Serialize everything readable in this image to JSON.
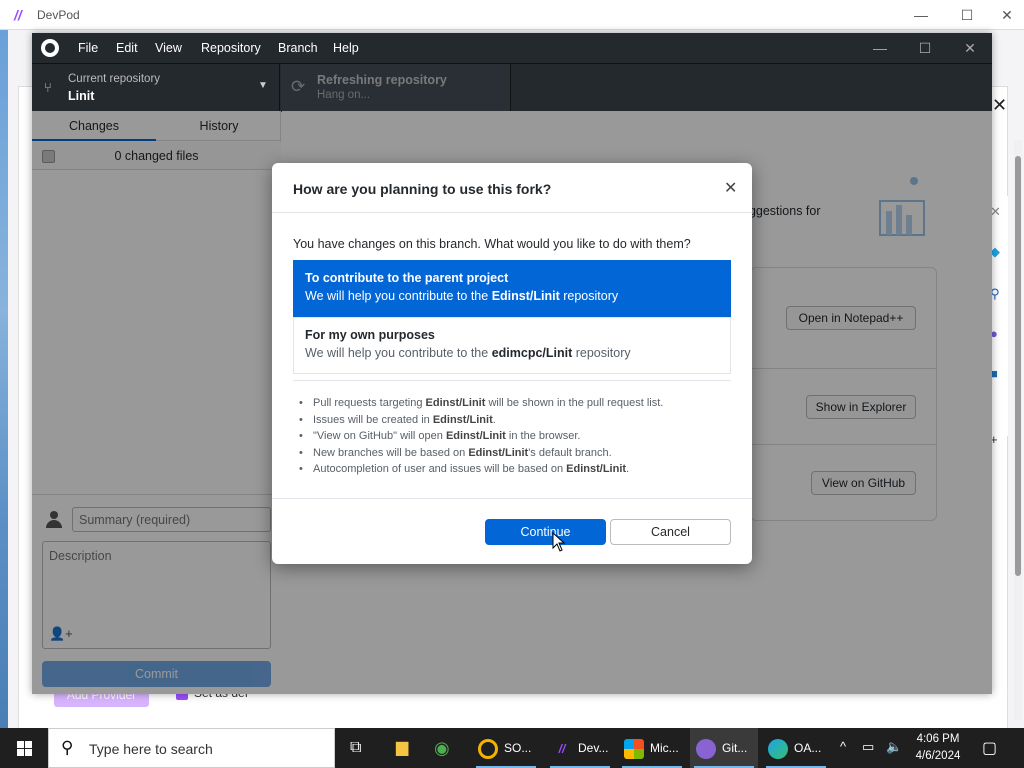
{
  "devpod": {
    "title": "DevPod",
    "logo": "//",
    "minimize_icon": "—",
    "maximize_icon": "☐",
    "close_icon": "✕",
    "panel_close": "✕",
    "add_provider": "Add Provider",
    "set_default": "Set as def"
  },
  "github": {
    "menu": [
      "File",
      "Edit",
      "View",
      "Repository",
      "Branch",
      "Help"
    ],
    "window_controls": {
      "minimize": "—",
      "maximize": "☐",
      "close": "✕"
    },
    "toolbar": {
      "repo_label": "Current repository",
      "repo_value": "Linit",
      "refresh_label": "Refreshing repository",
      "refresh_value": "Hang on..."
    },
    "tabs": {
      "changes": "Changes",
      "history": "History"
    },
    "changed_files": "0 changed files",
    "summary_placeholder": "Summary (required)",
    "description_placeholder": "Description",
    "commit_label": "Commit",
    "suggestions_text": "uggestions for",
    "actions": {
      "notepad": "Open in Notepad++",
      "explorer": "Show in Explorer",
      "github": "View on GitHub"
    }
  },
  "dialog": {
    "title": "How are you planning to use this fork?",
    "close": "✕",
    "intro": "You have changes on this branch. What would you like to do with them?",
    "options": [
      {
        "heading": "To contribute to the parent project",
        "desc_before": "We will help you contribute to the ",
        "repo": "Edinst/Linit",
        "desc_after": " repository",
        "selected": true
      },
      {
        "heading": "For my own purposes",
        "desc_before": "We will help you contribute to the ",
        "repo": "edimcpc/Linit",
        "desc_after": " repository",
        "selected": false
      }
    ],
    "bullets": [
      {
        "before": "Pull requests targeting ",
        "bold": "Edinst/Linit",
        "after": " will be shown in the pull request list."
      },
      {
        "before": "Issues will be created in ",
        "bold": "Edinst/Linit",
        "after": "."
      },
      {
        "before": "\"View on GitHub\" will open ",
        "bold": "Edinst/Linit",
        "after": " in the browser."
      },
      {
        "before": "New branches will be based on ",
        "bold": "Edinst/Linit",
        "after": "'s default branch."
      },
      {
        "before": "Autocompletion of user and issues will be based on ",
        "bold": "Edinst/Linit",
        "after": "."
      }
    ],
    "continue": "Continue",
    "cancel": "Cancel"
  },
  "taskbar": {
    "search_placeholder": "Type here to search",
    "apps": [
      {
        "label": "SO...",
        "color": "#f2b400"
      },
      {
        "label": "Dev...",
        "color": "#9b4dff"
      },
      {
        "label": "Mic...",
        "color": "#f25022"
      },
      {
        "label": "Git...",
        "color": "#8a63d2"
      },
      {
        "label": "OA...",
        "color": "#1fa3e8"
      }
    ],
    "time": "4:06 PM",
    "date": "4/6/2024"
  },
  "colors": {
    "accent": "#0366d6",
    "devpod": "#9b4dff",
    "github_dark": "#24292e"
  }
}
